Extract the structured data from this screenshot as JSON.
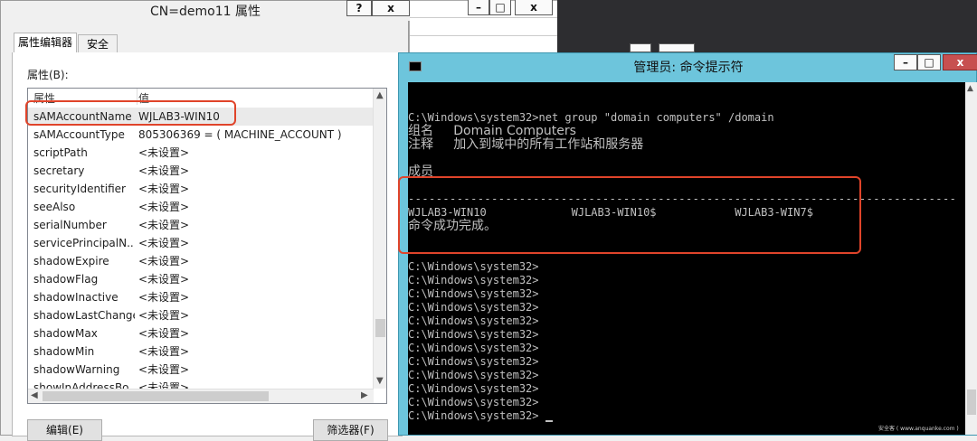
{
  "props": {
    "title": "CN=demo11 属性",
    "help_btn": "?",
    "close_btn": "x",
    "tabs": [
      {
        "label": "属性编辑器"
      },
      {
        "label": "安全"
      }
    ],
    "attributes_label": "属性(B):",
    "columns": {
      "attr": "属性",
      "value": "值"
    },
    "rows": [
      {
        "name": "sAMAccountName",
        "value": "WJLAB3-WIN10"
      },
      {
        "name": "sAMAccountType",
        "value": "805306369 = ( MACHINE_ACCOUNT )"
      },
      {
        "name": "scriptPath",
        "value": "<未设置>"
      },
      {
        "name": "secretary",
        "value": "<未设置>"
      },
      {
        "name": "securityIdentifier",
        "value": "<未设置>"
      },
      {
        "name": "seeAlso",
        "value": "<未设置>"
      },
      {
        "name": "serialNumber",
        "value": "<未设置>"
      },
      {
        "name": "servicePrincipalN...",
        "value": "<未设置>"
      },
      {
        "name": "shadowExpire",
        "value": "<未设置>"
      },
      {
        "name": "shadowFlag",
        "value": "<未设置>"
      },
      {
        "name": "shadowInactive",
        "value": "<未设置>"
      },
      {
        "name": "shadowLastChange",
        "value": "<未设置>"
      },
      {
        "name": "shadowMax",
        "value": "<未设置>"
      },
      {
        "name": "shadowMin",
        "value": "<未设置>"
      },
      {
        "name": "shadowWarning",
        "value": "<未设置>"
      },
      {
        "name": "showInAddressBo...",
        "value": "<未设置>"
      }
    ],
    "edit_btn": "编辑(E)",
    "filter_btn": "筛选器(F)"
  },
  "cmd": {
    "title": "管理员: 命令提示符",
    "lines": [
      "C:\\Windows\\system32>net group \"domain computers\" /domain",
      "组名     Domain Computers",
      "注释     加入到域中的所有工作站和服务器",
      "",
      "成员",
      "",
      "-------------------------------------------------------------------------------",
      "WJLAB3-WIN10             WJLAB3-WIN10$            WJLAB3-WIN7$",
      "命令成功完成。",
      "",
      "",
      "C:\\Windows\\system32>",
      "C:\\Windows\\system32>",
      "C:\\Windows\\system32>",
      "C:\\Windows\\system32>",
      "C:\\Windows\\system32>",
      "C:\\Windows\\system32>",
      "C:\\Windows\\system32>",
      "C:\\Windows\\system32>",
      "C:\\Windows\\system32>",
      "C:\\Windows\\system32>",
      "C:\\Windows\\system32>",
      "C:\\Windows\\system32>"
    ]
  },
  "watermark": "安全客 ( www.anquanke.com )",
  "colors": {
    "highlight": "#e0442a",
    "cmd_frame": "#6dc5dc"
  }
}
